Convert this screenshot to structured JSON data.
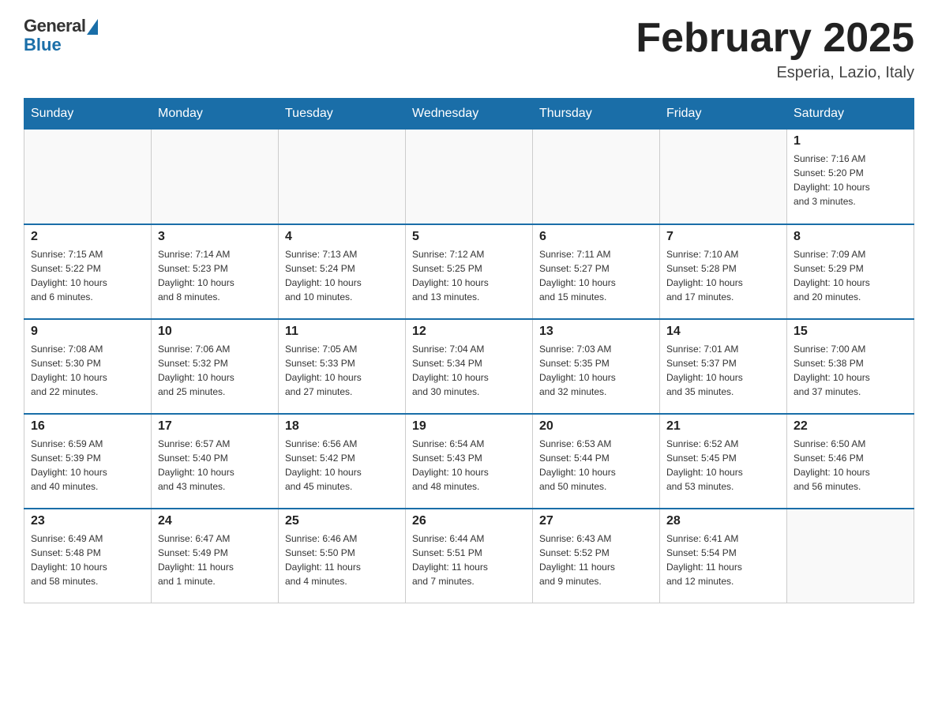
{
  "header": {
    "logo": {
      "general": "General",
      "blue": "Blue"
    },
    "title": "February 2025",
    "location": "Esperia, Lazio, Italy"
  },
  "weekdays": [
    "Sunday",
    "Monday",
    "Tuesday",
    "Wednesday",
    "Thursday",
    "Friday",
    "Saturday"
  ],
  "weeks": [
    [
      {
        "day": "",
        "info": ""
      },
      {
        "day": "",
        "info": ""
      },
      {
        "day": "",
        "info": ""
      },
      {
        "day": "",
        "info": ""
      },
      {
        "day": "",
        "info": ""
      },
      {
        "day": "",
        "info": ""
      },
      {
        "day": "1",
        "info": "Sunrise: 7:16 AM\nSunset: 5:20 PM\nDaylight: 10 hours\nand 3 minutes."
      }
    ],
    [
      {
        "day": "2",
        "info": "Sunrise: 7:15 AM\nSunset: 5:22 PM\nDaylight: 10 hours\nand 6 minutes."
      },
      {
        "day": "3",
        "info": "Sunrise: 7:14 AM\nSunset: 5:23 PM\nDaylight: 10 hours\nand 8 minutes."
      },
      {
        "day": "4",
        "info": "Sunrise: 7:13 AM\nSunset: 5:24 PM\nDaylight: 10 hours\nand 10 minutes."
      },
      {
        "day": "5",
        "info": "Sunrise: 7:12 AM\nSunset: 5:25 PM\nDaylight: 10 hours\nand 13 minutes."
      },
      {
        "day": "6",
        "info": "Sunrise: 7:11 AM\nSunset: 5:27 PM\nDaylight: 10 hours\nand 15 minutes."
      },
      {
        "day": "7",
        "info": "Sunrise: 7:10 AM\nSunset: 5:28 PM\nDaylight: 10 hours\nand 17 minutes."
      },
      {
        "day": "8",
        "info": "Sunrise: 7:09 AM\nSunset: 5:29 PM\nDaylight: 10 hours\nand 20 minutes."
      }
    ],
    [
      {
        "day": "9",
        "info": "Sunrise: 7:08 AM\nSunset: 5:30 PM\nDaylight: 10 hours\nand 22 minutes."
      },
      {
        "day": "10",
        "info": "Sunrise: 7:06 AM\nSunset: 5:32 PM\nDaylight: 10 hours\nand 25 minutes."
      },
      {
        "day": "11",
        "info": "Sunrise: 7:05 AM\nSunset: 5:33 PM\nDaylight: 10 hours\nand 27 minutes."
      },
      {
        "day": "12",
        "info": "Sunrise: 7:04 AM\nSunset: 5:34 PM\nDaylight: 10 hours\nand 30 minutes."
      },
      {
        "day": "13",
        "info": "Sunrise: 7:03 AM\nSunset: 5:35 PM\nDaylight: 10 hours\nand 32 minutes."
      },
      {
        "day": "14",
        "info": "Sunrise: 7:01 AM\nSunset: 5:37 PM\nDaylight: 10 hours\nand 35 minutes."
      },
      {
        "day": "15",
        "info": "Sunrise: 7:00 AM\nSunset: 5:38 PM\nDaylight: 10 hours\nand 37 minutes."
      }
    ],
    [
      {
        "day": "16",
        "info": "Sunrise: 6:59 AM\nSunset: 5:39 PM\nDaylight: 10 hours\nand 40 minutes."
      },
      {
        "day": "17",
        "info": "Sunrise: 6:57 AM\nSunset: 5:40 PM\nDaylight: 10 hours\nand 43 minutes."
      },
      {
        "day": "18",
        "info": "Sunrise: 6:56 AM\nSunset: 5:42 PM\nDaylight: 10 hours\nand 45 minutes."
      },
      {
        "day": "19",
        "info": "Sunrise: 6:54 AM\nSunset: 5:43 PM\nDaylight: 10 hours\nand 48 minutes."
      },
      {
        "day": "20",
        "info": "Sunrise: 6:53 AM\nSunset: 5:44 PM\nDaylight: 10 hours\nand 50 minutes."
      },
      {
        "day": "21",
        "info": "Sunrise: 6:52 AM\nSunset: 5:45 PM\nDaylight: 10 hours\nand 53 minutes."
      },
      {
        "day": "22",
        "info": "Sunrise: 6:50 AM\nSunset: 5:46 PM\nDaylight: 10 hours\nand 56 minutes."
      }
    ],
    [
      {
        "day": "23",
        "info": "Sunrise: 6:49 AM\nSunset: 5:48 PM\nDaylight: 10 hours\nand 58 minutes."
      },
      {
        "day": "24",
        "info": "Sunrise: 6:47 AM\nSunset: 5:49 PM\nDaylight: 11 hours\nand 1 minute."
      },
      {
        "day": "25",
        "info": "Sunrise: 6:46 AM\nSunset: 5:50 PM\nDaylight: 11 hours\nand 4 minutes."
      },
      {
        "day": "26",
        "info": "Sunrise: 6:44 AM\nSunset: 5:51 PM\nDaylight: 11 hours\nand 7 minutes."
      },
      {
        "day": "27",
        "info": "Sunrise: 6:43 AM\nSunset: 5:52 PM\nDaylight: 11 hours\nand 9 minutes."
      },
      {
        "day": "28",
        "info": "Sunrise: 6:41 AM\nSunset: 5:54 PM\nDaylight: 11 hours\nand 12 minutes."
      },
      {
        "day": "",
        "info": ""
      }
    ]
  ]
}
